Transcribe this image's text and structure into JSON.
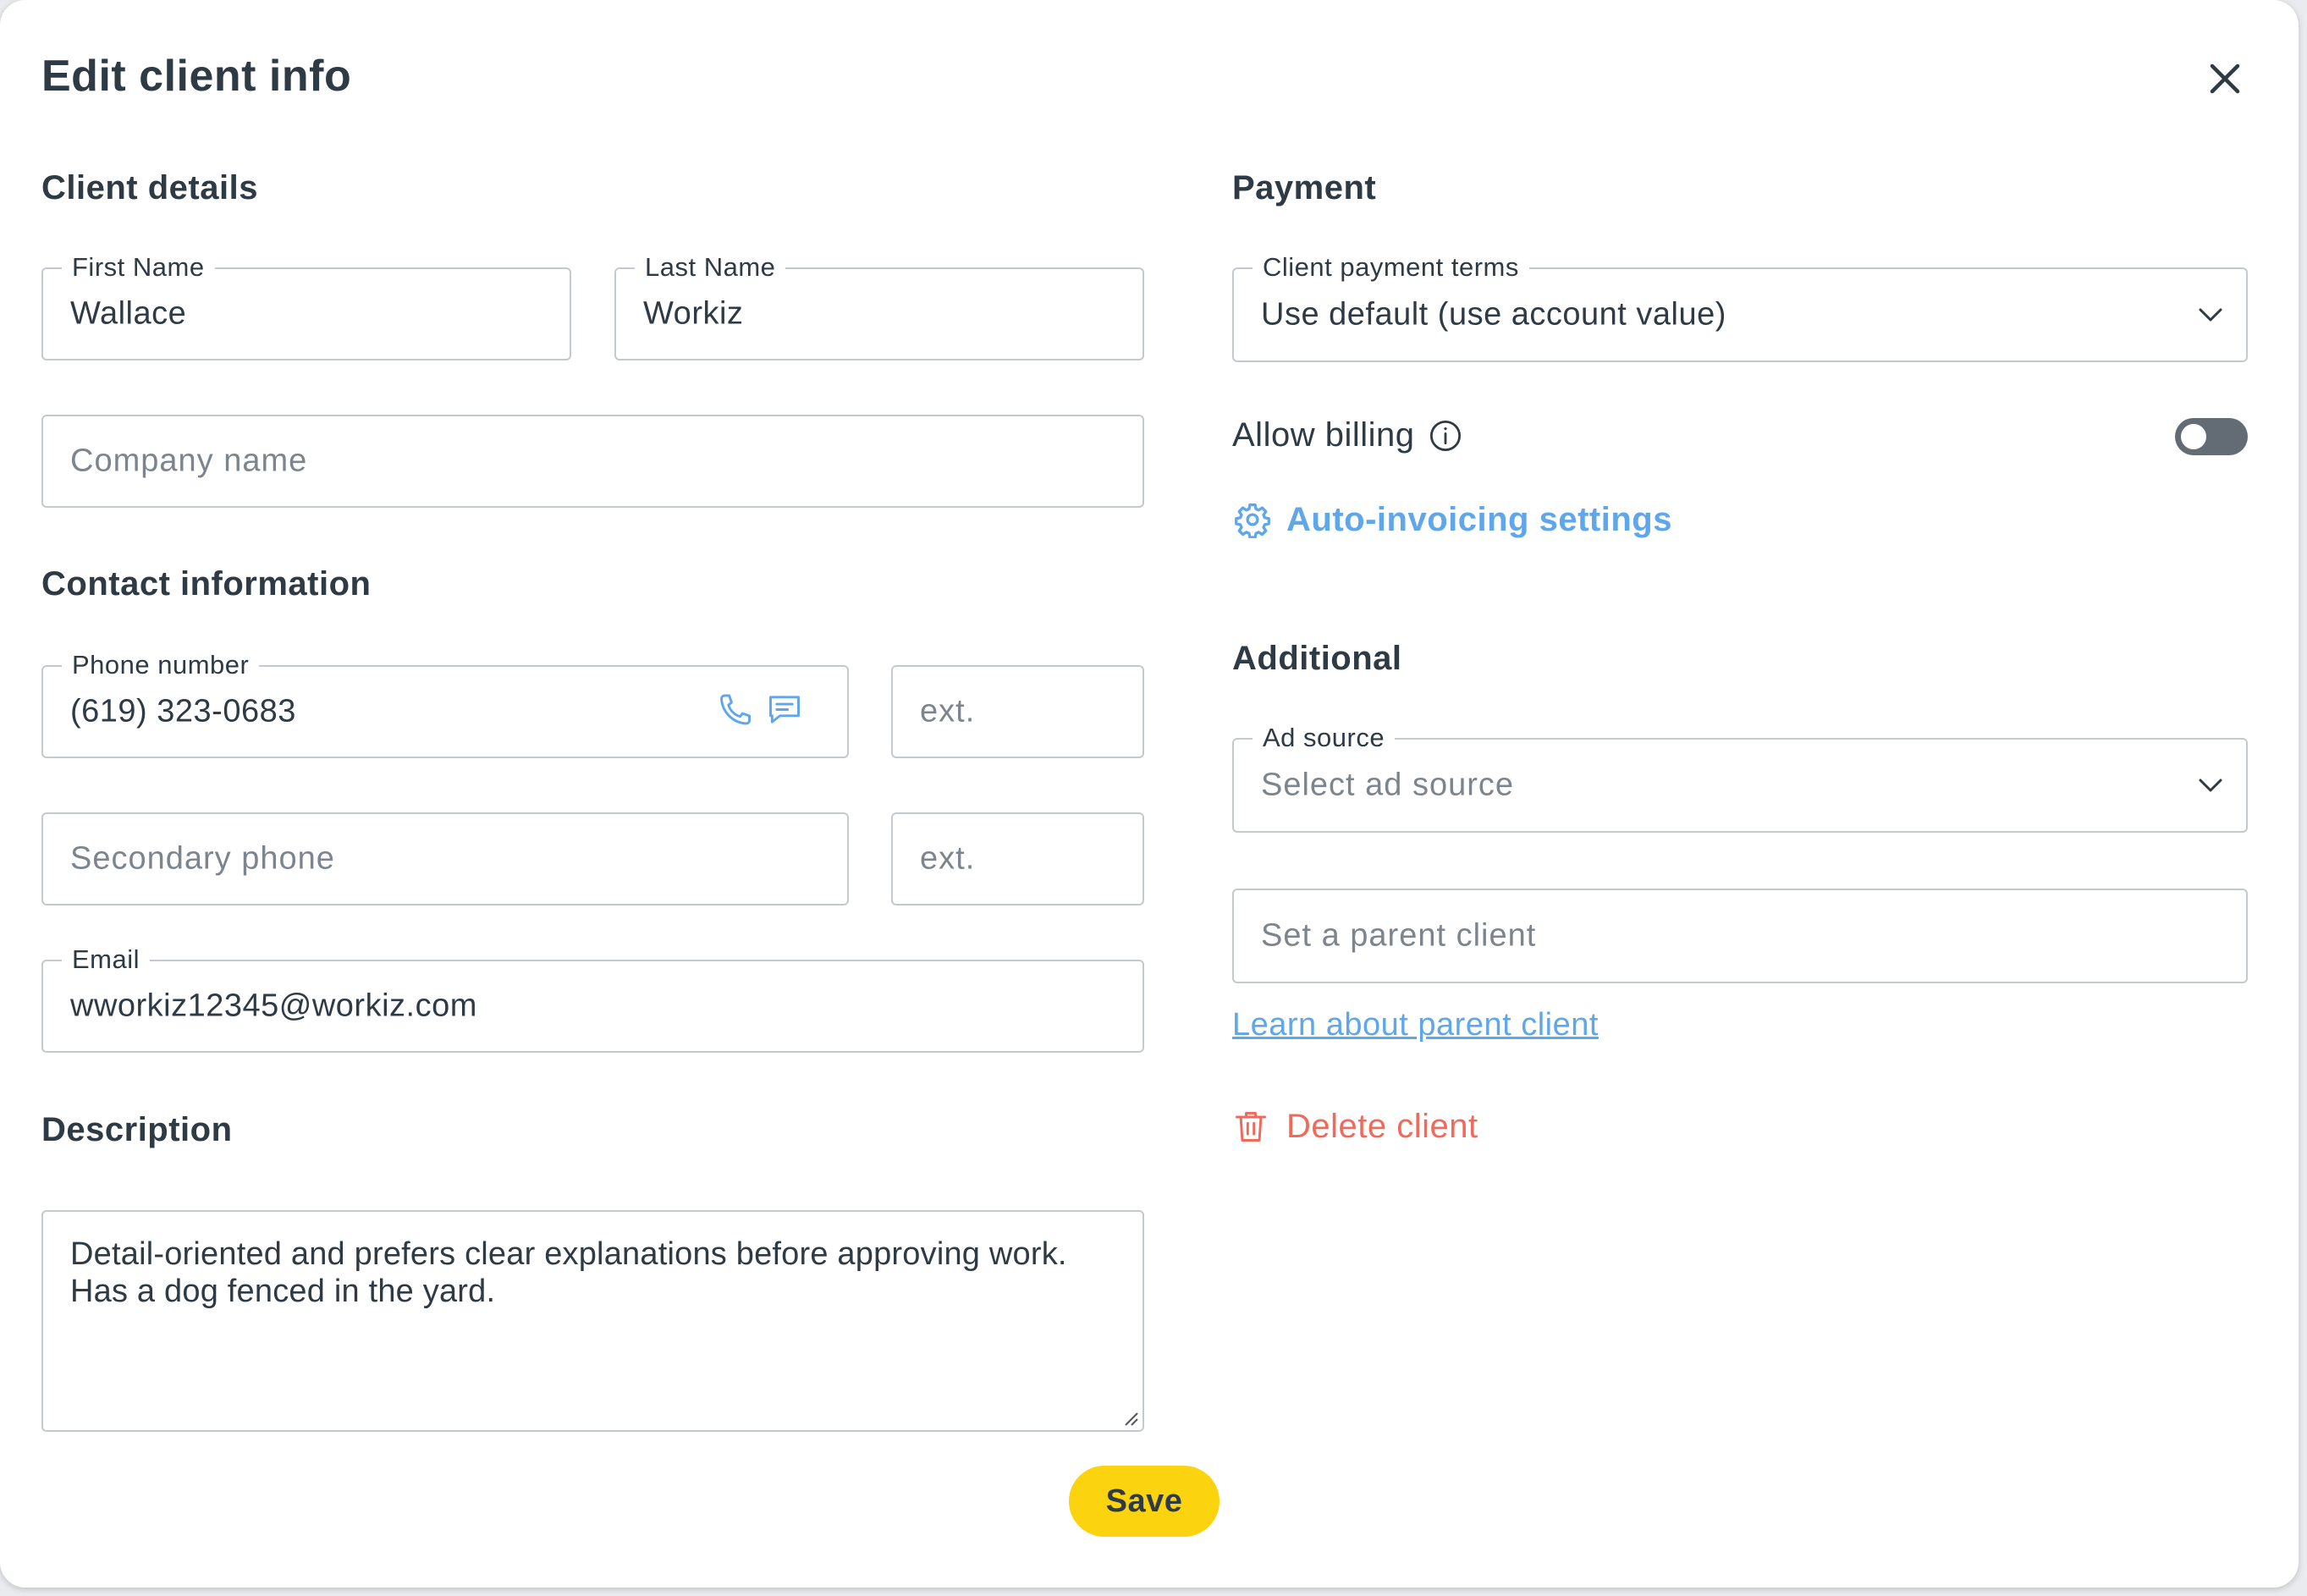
{
  "modal": {
    "title": "Edit client info"
  },
  "client_details": {
    "title": "Client details",
    "first_name": {
      "label": "First Name",
      "value": "Wallace"
    },
    "last_name": {
      "label": "Last Name",
      "value": "Workiz"
    },
    "company": {
      "placeholder": "Company name"
    }
  },
  "contact": {
    "title": "Contact information",
    "phone": {
      "label": "Phone number",
      "value": "(619) 323-0683",
      "ext_placeholder": "ext."
    },
    "secondary_phone": {
      "placeholder": "Secondary phone",
      "ext_placeholder": "ext."
    },
    "email": {
      "label": "Email",
      "value": "wworkiz12345@workiz.com"
    }
  },
  "description": {
    "title": "Description",
    "text": "Detail-oriented and prefers clear explanations before approving work. Has a dog fenced in the yard."
  },
  "payment": {
    "title": "Payment",
    "terms": {
      "label": "Client payment terms",
      "value": "Use default (use account value)"
    },
    "allow_billing": {
      "label": "Allow billing",
      "enabled": false
    },
    "auto_invoicing_label": "Auto-invoicing settings"
  },
  "additional": {
    "title": "Additional",
    "ad_source": {
      "label": "Ad source",
      "placeholder": "Select ad source"
    },
    "parent_client": {
      "placeholder": "Set a parent client"
    },
    "learn_link": "Learn about parent client",
    "delete_label": "Delete client"
  },
  "actions": {
    "save_label": "Save"
  },
  "colors": {
    "accent_blue": "#5fa6ea",
    "danger": "#f06a5c",
    "save_yellow": "#fcd30f",
    "text": "#2e3a44"
  },
  "icons": {
    "close": "close-icon",
    "phone": "phone-icon",
    "sms": "message-icon",
    "info": "info-icon",
    "gear": "gear-icon",
    "trash": "trash-icon",
    "chevron": "chevron-down-icon"
  }
}
